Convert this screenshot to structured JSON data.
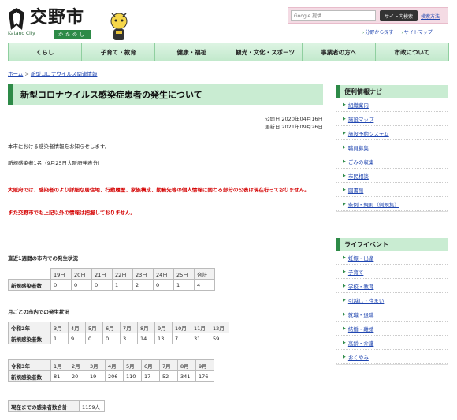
{
  "header": {
    "logo_name": "交野市",
    "logo_en": "Katano City",
    "logo_kana": "かたのし",
    "search_placeholder": "Google 提供",
    "search_button": "サイト内検索",
    "search_help": "検索方法",
    "sub_links": [
      "分野から探す",
      "サイトマップ"
    ]
  },
  "nav": [
    "くらし",
    "子育て・教育",
    "健康・福祉",
    "観光・文化・スポーツ",
    "事業者の方へ",
    "市政について"
  ],
  "breadcrumb": {
    "home": "ホーム",
    "sep": " > ",
    "current": "新型コロナウイルス関連情報"
  },
  "main": {
    "title": "新型コロナウイルス感染症患者の発生について",
    "published": "公開日 2020年04月16日",
    "updated": "更新日 2021年09月26日",
    "intro": "本市における感染者情報をお知らせします。",
    "new_cases": "新規感染者1名（9月25日大阪府発表分）",
    "red1": "大阪府では、感染者のより詳細な居住地、行動履歴、家族構成、勤務先等の個人情報に関わる部分の公表は現在行っておりません。",
    "red2": "また交野市でも上記以外の情報は把握しておりません。",
    "weekly_label": "直近1週間の市内での発生状況",
    "weekly": {
      "headers": [
        "",
        "19日",
        "20日",
        "21日",
        "22日",
        "23日",
        "24日",
        "25日",
        "合計"
      ],
      "row": [
        "新規感染者数",
        "0",
        "0",
        "0",
        "1",
        "2",
        "0",
        "1",
        "4"
      ]
    },
    "monthly_label": "月ごとの市内での発生状況",
    "r2": {
      "headers": [
        "令和2年",
        "3月",
        "4月",
        "5月",
        "6月",
        "7月",
        "8月",
        "9月",
        "10月",
        "11月",
        "12月"
      ],
      "row": [
        "新規感染者数",
        "1",
        "9",
        "0",
        "0",
        "3",
        "14",
        "13",
        "7",
        "31",
        "59"
      ]
    },
    "r3": {
      "headers": [
        "令和3年",
        "1月",
        "2月",
        "3月",
        "4月",
        "5月",
        "6月",
        "7月",
        "8月",
        "9月"
      ],
      "row": [
        "新規感染者数",
        "81",
        "20",
        "19",
        "206",
        "110",
        "17",
        "52",
        "341",
        "176"
      ]
    },
    "total_label": "現在までの感染者数合計",
    "total_value": "1159人"
  },
  "sidebar": {
    "nav_title": "便利情報ナビ",
    "nav_items": [
      "組織案内",
      "施設マップ",
      "施設予約システム",
      "職員募集",
      "ごみの収集",
      "市民相談",
      "図書館",
      "条例・規則（例規集）"
    ],
    "life_title": "ライフイベント",
    "life_items": [
      "妊娠・出産",
      "子育て",
      "学校・教育",
      "引越し・住まい",
      "就職・退職",
      "結婚・離婚",
      "高齢・介護",
      "おくやみ"
    ]
  },
  "colors": {
    "accent": "#2d8a47",
    "nav_bg": "#c9ecd2",
    "link": "#2046b0",
    "alert": "#d40000"
  }
}
